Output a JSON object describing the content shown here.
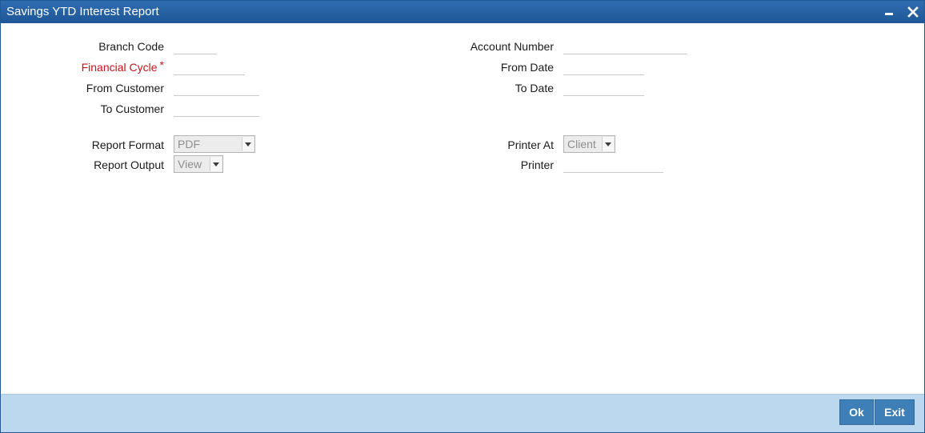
{
  "window": {
    "title": "Savings YTD Interest Report"
  },
  "form": {
    "branch_code_label": "Branch Code",
    "financial_cycle_label": "Financial Cycle",
    "required_mark": "*",
    "from_customer_label": "From Customer",
    "to_customer_label": "To Customer",
    "report_format_label": "Report Format",
    "report_format_value": "PDF",
    "report_output_label": "Report Output",
    "report_output_value": "View",
    "account_number_label": "Account Number",
    "from_date_label": "From Date",
    "to_date_label": "To Date",
    "printer_at_label": "Printer At",
    "printer_at_value": "Client",
    "printer_label": "Printer"
  },
  "footer": {
    "ok_label": "Ok",
    "exit_label": "Exit"
  },
  "colors": {
    "title_bar": "#1e5797",
    "required": "#c4161c",
    "footer_bg": "#bcd8ee",
    "button": "#3f7fb7"
  },
  "icons": {
    "minimize": "minimize-icon",
    "close": "close-icon",
    "dropdown": "chevron-down-icon"
  }
}
